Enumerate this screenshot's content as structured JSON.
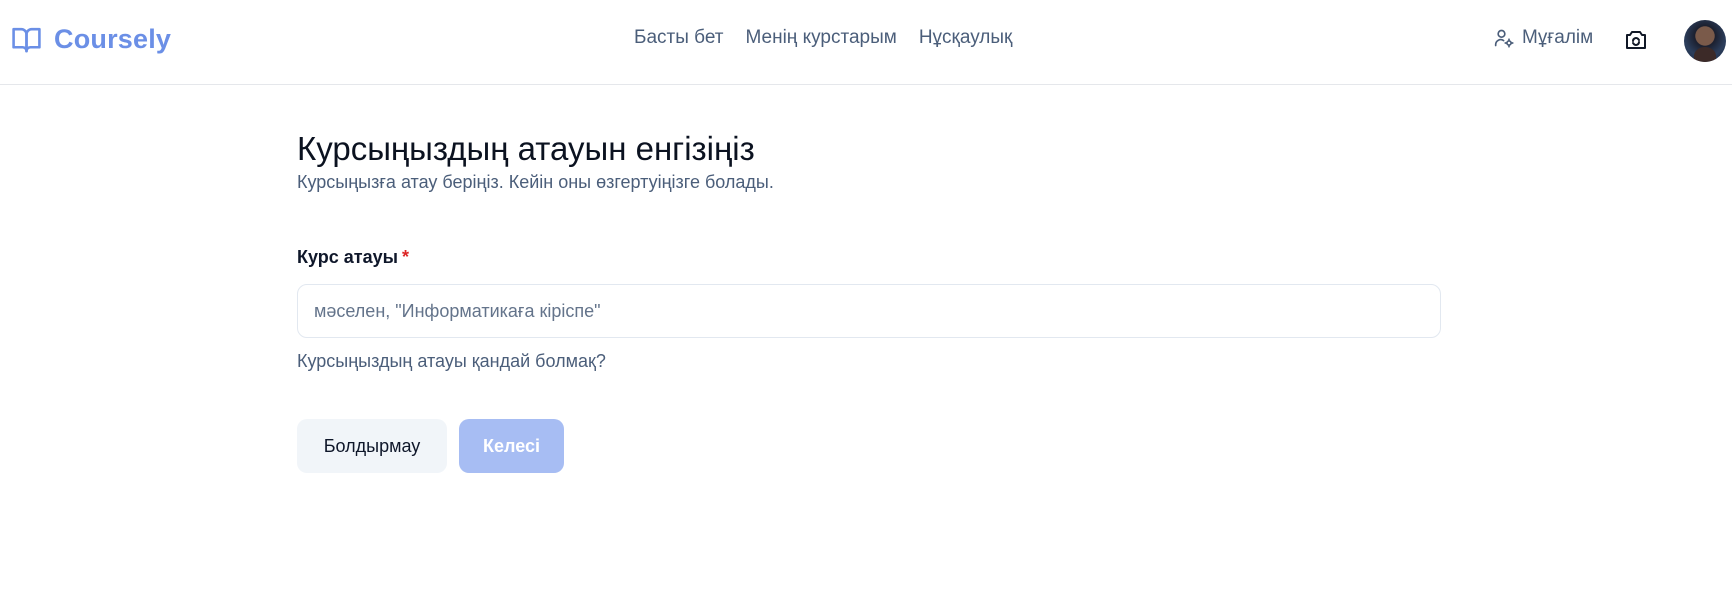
{
  "header": {
    "brand": "Coursely",
    "nav": [
      "Басты бет",
      "Менің курстарым",
      "Нұсқаулық"
    ],
    "role_label": "Мұғалім"
  },
  "form": {
    "title": "Курсыңыздың атауын енгізіңіз",
    "subtitle": "Курсыңызға атау беріңіз. Кейін оны өзгертуіңізге болады.",
    "field_label": "Курс атауы",
    "required_mark": "*",
    "input_value": "",
    "input_placeholder": "мәселен, \"Информатикаға кіріспе\"",
    "hint": "Курсыңыздың атауы қандай болмақ?",
    "cancel_label": "Болдырмау",
    "next_label": "Келесі"
  },
  "icons": {
    "brand": "book-open-icon",
    "role": "user-cog-icon",
    "switch": "camera-switch-icon"
  },
  "colors": {
    "brand": "#6b8fe6",
    "next_disabled_bg": "#a7bdf3",
    "required": "#dc2626"
  }
}
